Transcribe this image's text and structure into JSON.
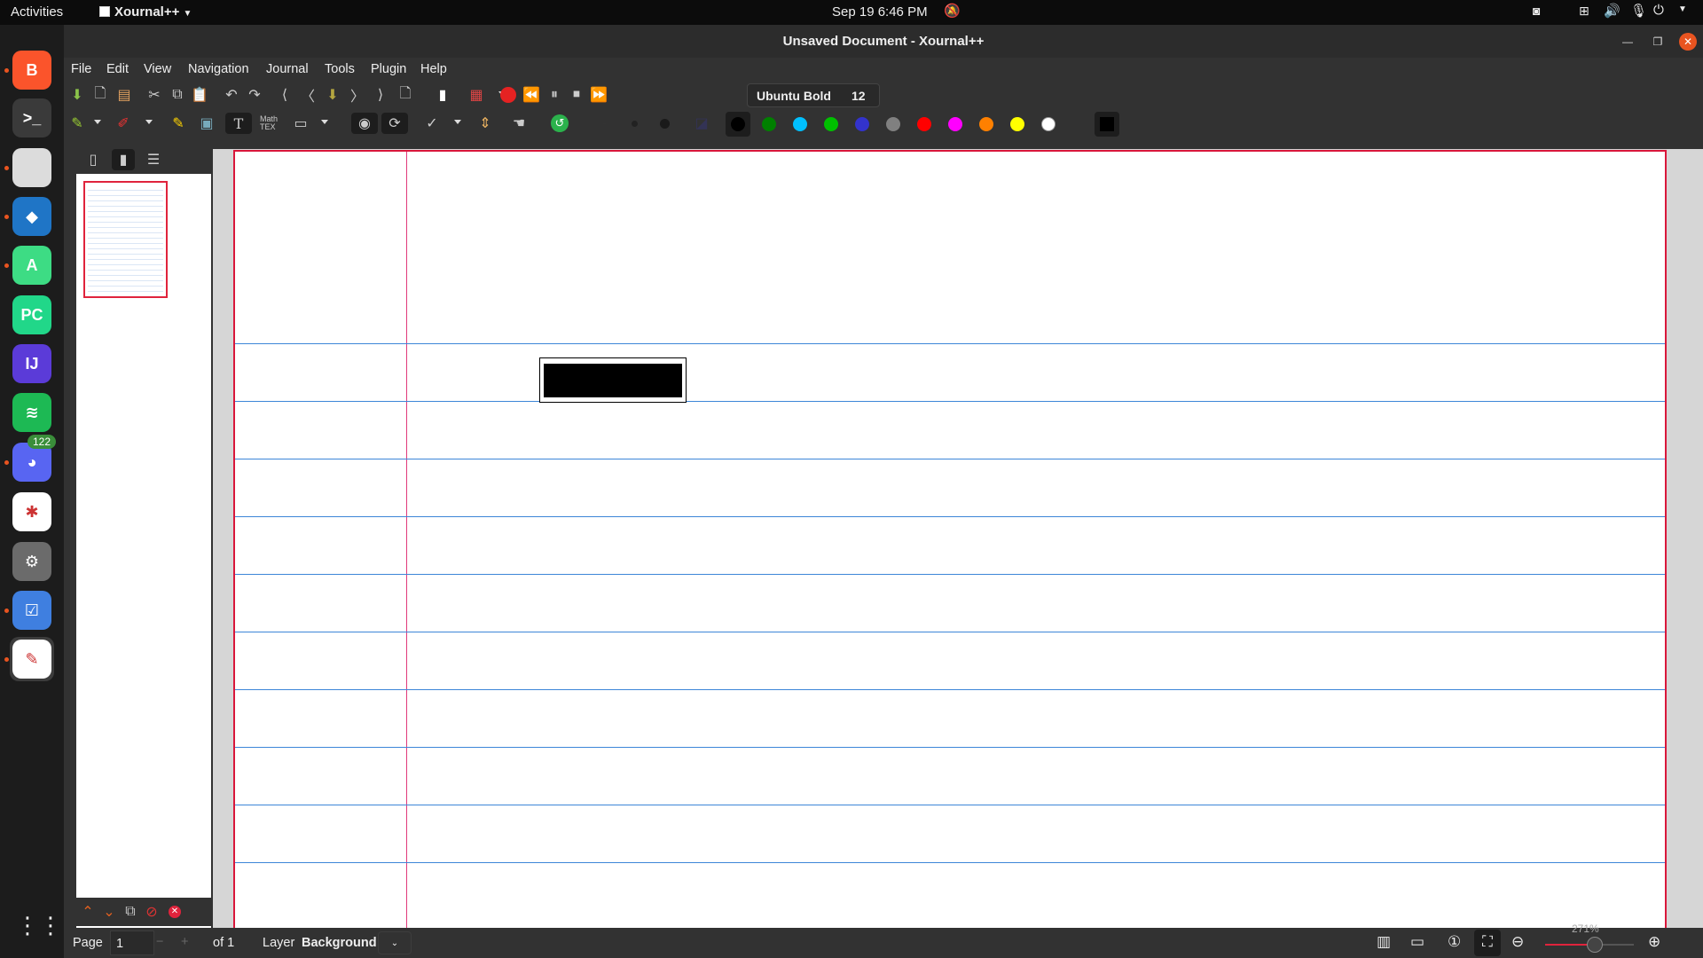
{
  "topbar": {
    "activities": "Activities",
    "app_name": "Xournal++",
    "clock": "Sep 19   6:46 PM"
  },
  "dock": {
    "items": [
      {
        "name": "brave",
        "color": "#fb542b",
        "glyph": "B"
      },
      {
        "name": "terminal",
        "color": "#3a3a3a",
        "glyph": ">_"
      },
      {
        "name": "files",
        "color": "#dcdcdc",
        "glyph": ""
      },
      {
        "name": "vscode",
        "color": "#1f75c6",
        "glyph": "◆"
      },
      {
        "name": "android-studio",
        "color": "#3ddc84",
        "glyph": "A"
      },
      {
        "name": "pycharm",
        "color": "#21d789",
        "glyph": "PC"
      },
      {
        "name": "intellij",
        "color": "#5b3bd8",
        "glyph": "IJ"
      },
      {
        "name": "spotify",
        "color": "#1db954",
        "glyph": "≋"
      },
      {
        "name": "discord",
        "color": "#5865f2",
        "glyph": "◕"
      },
      {
        "name": "slack",
        "color": "#ffffff",
        "glyph": "✱"
      },
      {
        "name": "settings",
        "color": "#6b6b6b",
        "glyph": "⚙"
      },
      {
        "name": "tasks",
        "color": "#3f7fe0",
        "glyph": "☑"
      },
      {
        "name": "xournalpp",
        "color": "#ffffff",
        "glyph": "✎"
      }
    ],
    "discord_badge": "122"
  },
  "window": {
    "title": "Unsaved Document - Xournal++"
  },
  "menu": [
    "File",
    "Edit",
    "View",
    "Navigation",
    "Journal",
    "Tools",
    "Plugin",
    "Help"
  ],
  "font": {
    "name": "Ubuntu Bold",
    "size": "12"
  },
  "palette": {
    "colors": [
      "#000000",
      "#008000",
      "#00c0ff",
      "#00c000",
      "#3333cc",
      "#808080",
      "#ff0000",
      "#ff00ff",
      "#ff8000",
      "#ffff00",
      "#ffffff"
    ],
    "selected_color": "#000000"
  },
  "status": {
    "page_label": "Page",
    "page_value": "1",
    "of_label": "of 1",
    "layer_label": "Layer",
    "layer_value": "Background",
    "zoom": "271%"
  }
}
